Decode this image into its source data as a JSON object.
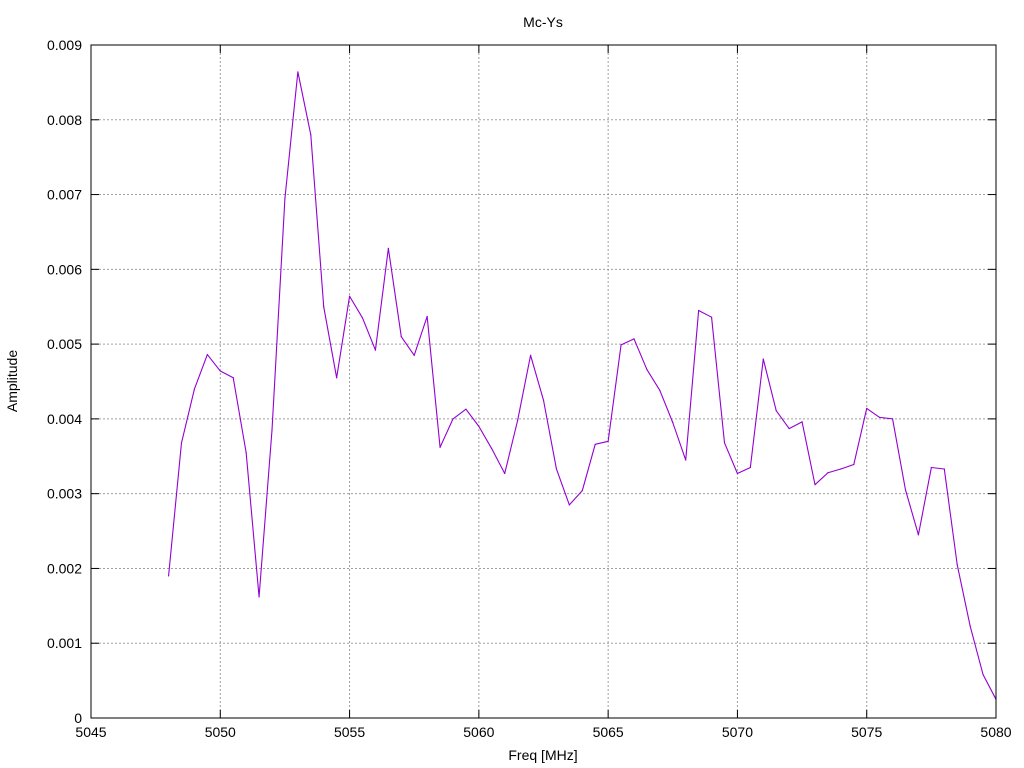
{
  "chart_data": {
    "type": "line",
    "title": "Mc-Ys",
    "xlabel": "Freq [MHz]",
    "ylabel": "Amplitude",
    "xlim": [
      5045,
      5080
    ],
    "ylim": [
      0,
      0.009
    ],
    "grid": true,
    "xticks": [
      5045,
      5050,
      5055,
      5060,
      5065,
      5070,
      5075,
      5080
    ],
    "xtick_labels": [
      "5045",
      "5050",
      "5055",
      "5060",
      "5065",
      "5070",
      "5075",
      "5080"
    ],
    "yticks": [
      0,
      0.001,
      0.002,
      0.003,
      0.004,
      0.005,
      0.006,
      0.007,
      0.008,
      0.009
    ],
    "ytick_labels": [
      "0",
      "0.001",
      "0.002",
      "0.003",
      "0.004",
      "0.005",
      "0.006",
      "0.007",
      "0.008",
      "0.009"
    ],
    "colors": {
      "line": "#9400d3",
      "grid": "#a0a0a0",
      "frame": "#000000"
    },
    "series": [
      {
        "x": [
          5048,
          5048.5,
          5049,
          5049.5,
          5050,
          5050.5,
          5051,
          5051.5,
          5052,
          5052.5,
          5053,
          5053.5,
          5054,
          5054.5,
          5055,
          5055.5,
          5056,
          5056.5,
          5057,
          5057.5,
          5058,
          5058.5,
          5059,
          5059.5,
          5060,
          5060.5,
          5061,
          5061.5,
          5062,
          5062.5,
          5063,
          5063.5,
          5064,
          5064.5,
          5065,
          5065.5,
          5066,
          5066.5,
          5067,
          5067.5,
          5068,
          5068.5,
          5069,
          5069.5,
          5070,
          5070.5,
          5071,
          5071.5,
          5072,
          5072.5,
          5073,
          5073.5,
          5074,
          5074.5,
          5075,
          5075.5,
          5076,
          5076.5,
          5077,
          5077.5,
          5078,
          5078.5,
          5079,
          5079.5,
          5080
        ],
        "values": [
          0.0019,
          0.00368,
          0.0044,
          0.00486,
          0.00464,
          0.00455,
          0.00355,
          0.00162,
          0.00385,
          0.00695,
          0.00864,
          0.0078,
          0.0055,
          0.00455,
          0.00564,
          0.00535,
          0.00492,
          0.00628,
          0.0051,
          0.00485,
          0.00537,
          0.00362,
          0.004,
          0.00413,
          0.0039,
          0.0036,
          0.00327,
          0.00398,
          0.00485,
          0.00425,
          0.00333,
          0.00285,
          0.00304,
          0.00366,
          0.0037,
          0.00499,
          0.00507,
          0.00466,
          0.00438,
          0.00395,
          0.00345,
          0.00545,
          0.00536,
          0.00368,
          0.00327,
          0.00335,
          0.0048,
          0.00411,
          0.00387,
          0.00396,
          0.00312,
          0.00328,
          0.00333,
          0.00339,
          0.00414,
          0.00402,
          0.004,
          0.00305,
          0.00245,
          0.00335,
          0.00333,
          0.00205,
          0.00123,
          0.00058,
          0.00025
        ]
      }
    ]
  }
}
